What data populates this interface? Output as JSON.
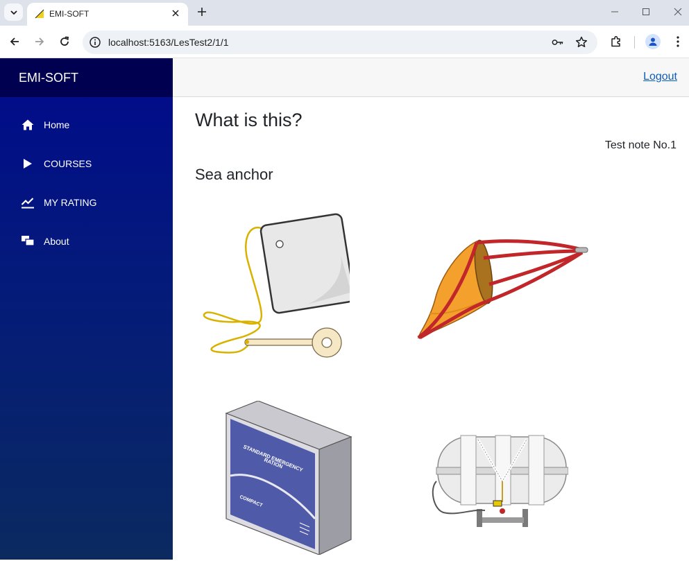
{
  "browser": {
    "tab_title": "EMI-SOFT",
    "url": "localhost:5163/LesTest2/1/1"
  },
  "app": {
    "brand": "EMI-SOFT",
    "logout_label": "Logout"
  },
  "sidebar": {
    "items": [
      {
        "label": "Home",
        "icon": "home-icon"
      },
      {
        "label": "COURSES",
        "icon": "play-icon"
      },
      {
        "label": "MY RATING",
        "icon": "chart-line-icon"
      },
      {
        "label": "About",
        "icon": "chat-icon"
      }
    ]
  },
  "question": {
    "title": "What is this?",
    "test_note": "Test note No.1",
    "answer": "Sea anchor"
  },
  "options": [
    {
      "name": "whistle-tag"
    },
    {
      "name": "sea-anchor"
    },
    {
      "name": "emergency-ration"
    },
    {
      "name": "liferaft"
    }
  ],
  "ration_box": {
    "line1": "STANDARD EMERGENCY",
    "line2": "RATION",
    "brand": "COMPACT"
  },
  "colors": {
    "sidebar_top": "#000050",
    "sidebar": "#000a8c",
    "link": "#0d5db7",
    "drogue_orange": "#f3a02c",
    "drogue_red": "#c0262a",
    "ration_blue": "#4f5aa8"
  }
}
